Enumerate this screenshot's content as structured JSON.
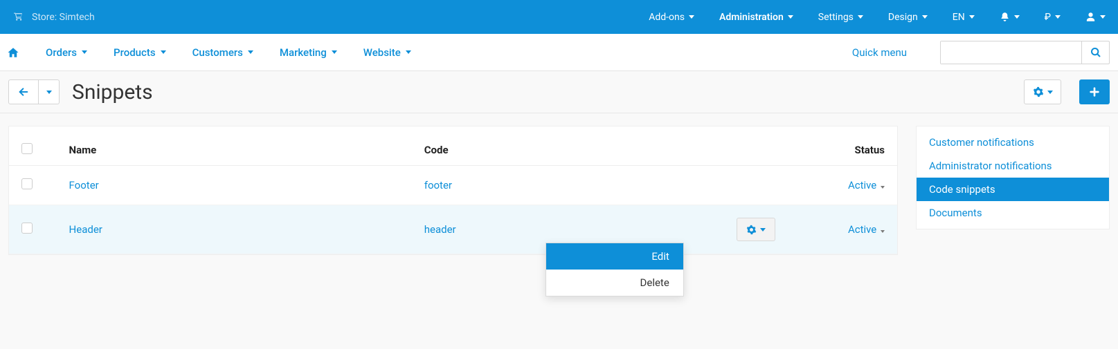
{
  "topbar": {
    "store_label": "Store: Simtech",
    "menu": {
      "addons": "Add-ons",
      "administration": "Administration",
      "settings": "Settings",
      "design": "Design",
      "lang": "EN",
      "currency": "₽"
    }
  },
  "navbar": {
    "orders": "Orders",
    "products": "Products",
    "customers": "Customers",
    "marketing": "Marketing",
    "website": "Website",
    "quick_menu": "Quick menu",
    "search_placeholder": ""
  },
  "page": {
    "title": "Snippets"
  },
  "table": {
    "headers": {
      "name": "Name",
      "code": "Code",
      "status": "Status"
    },
    "rows": [
      {
        "name": "Footer",
        "code": "footer",
        "status": "Active"
      },
      {
        "name": "Header",
        "code": "header",
        "status": "Active"
      }
    ]
  },
  "row_menu": {
    "edit": "Edit",
    "delete": "Delete"
  },
  "sidebar": {
    "items": [
      {
        "label": "Customer notifications"
      },
      {
        "label": "Administrator notifications"
      },
      {
        "label": "Code snippets"
      },
      {
        "label": "Documents"
      }
    ],
    "active_index": 2
  }
}
